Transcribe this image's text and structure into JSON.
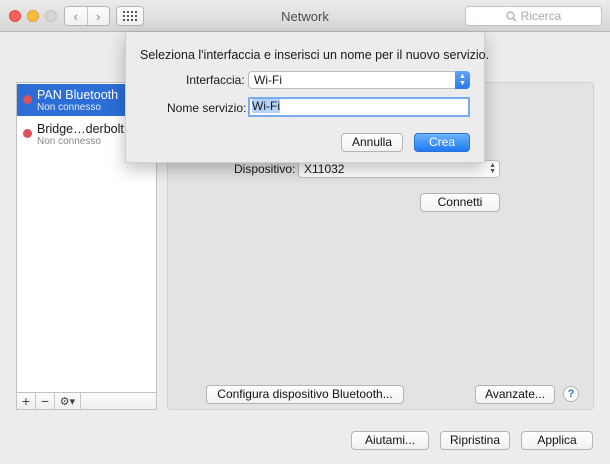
{
  "window": {
    "title": "Network",
    "search_placeholder": "Ricerca",
    "nav_back": "‹",
    "nav_forward": "›"
  },
  "services": [
    {
      "name": "PAN Bluetooth",
      "status": "Non connesso",
      "selected": true
    },
    {
      "name": "Bridge…derbolt",
      "status": "Non connesso",
      "selected": false
    }
  ],
  "sidebar_tools": {
    "add": "+",
    "remove": "−",
    "gear": "⚙▾"
  },
  "panel": {
    "device_label": "Dispositivo:",
    "device_value": "X11032",
    "connect_button": "Connetti",
    "configure_button": "Configura dispositivo Bluetooth...",
    "advanced_button": "Avanzate...",
    "help": "?"
  },
  "footer": {
    "help_button": "Aiutami...",
    "revert_button": "Ripristina",
    "apply_button": "Applica"
  },
  "sheet": {
    "prompt": "Seleziona l'interfaccia e inserisci un nome per il nuovo servizio.",
    "interface_label": "Interfaccia:",
    "interface_value": "Wi-Fi",
    "service_name_label": "Nome servizio:",
    "service_name_value": "Wi-Fi",
    "cancel_button": "Annulla",
    "create_button": "Crea"
  },
  "colors": {
    "accent": "#2c6ed5",
    "status_dot": "#e0505a"
  }
}
